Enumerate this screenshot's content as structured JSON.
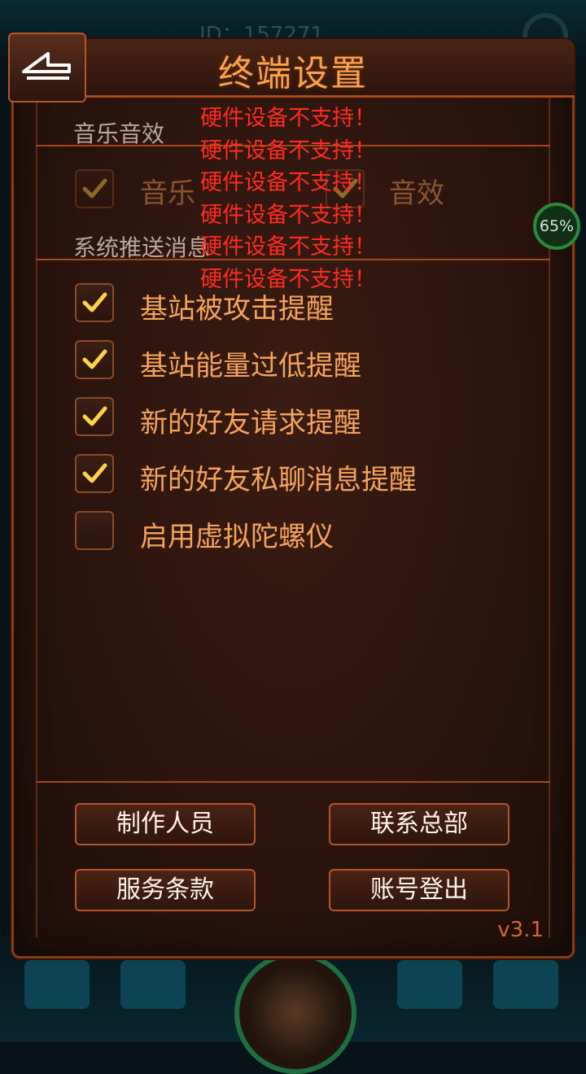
{
  "background": {
    "id_text": "ID：157271"
  },
  "header": {
    "title": "终端设置",
    "back_icon": "back-arrow-icon"
  },
  "sections": {
    "audio_label": "音乐音效",
    "push_label": "系统推送消息"
  },
  "audio_options": [
    {
      "label": "音乐",
      "checked": true
    },
    {
      "label": "音效",
      "checked": true
    }
  ],
  "push_options": [
    {
      "label": "基站被攻击提醒",
      "checked": true
    },
    {
      "label": "基站能量过低提醒",
      "checked": true
    },
    {
      "label": "新的好友请求提醒",
      "checked": true
    },
    {
      "label": "新的好友私聊消息提醒",
      "checked": true
    },
    {
      "label": "启用虚拟陀螺仪",
      "checked": false
    }
  ],
  "toasts": [
    "硬件设备不支持！",
    "硬件设备不支持！",
    "硬件设备不支持！",
    "硬件设备不支持！",
    "硬件设备不支持！",
    "硬件设备不支持！"
  ],
  "progress_badge": "65%",
  "buttons": {
    "credits": "制作人员",
    "contact": "联系总部",
    "terms": "服务条款",
    "logout": "账号登出"
  },
  "version": "v3.1",
  "colors": {
    "accent": "#f4a35a",
    "border": "#a4471b",
    "toast": "#ff2b1e"
  }
}
